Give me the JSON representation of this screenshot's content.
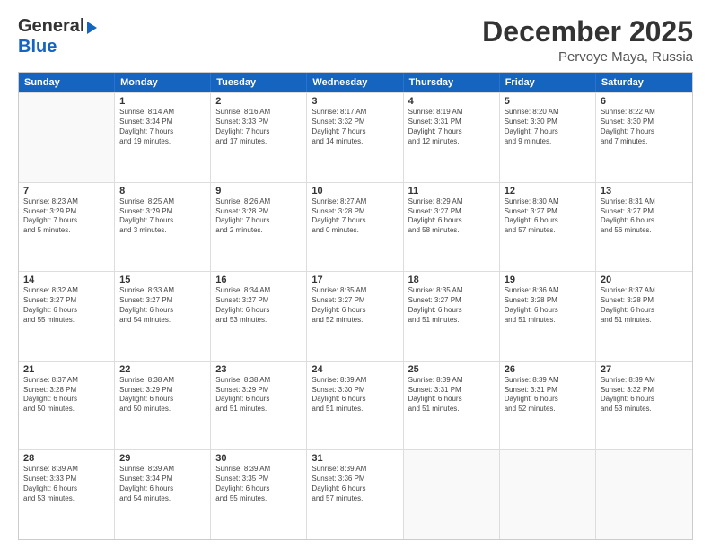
{
  "logo": {
    "line1": "General",
    "line2": "Blue"
  },
  "title": "December 2025",
  "location": "Pervoye Maya, Russia",
  "days": [
    "Sunday",
    "Monday",
    "Tuesday",
    "Wednesday",
    "Thursday",
    "Friday",
    "Saturday"
  ],
  "rows": [
    [
      {
        "day": "",
        "info": ""
      },
      {
        "day": "1",
        "info": "Sunrise: 8:14 AM\nSunset: 3:34 PM\nDaylight: 7 hours\nand 19 minutes."
      },
      {
        "day": "2",
        "info": "Sunrise: 8:16 AM\nSunset: 3:33 PM\nDaylight: 7 hours\nand 17 minutes."
      },
      {
        "day": "3",
        "info": "Sunrise: 8:17 AM\nSunset: 3:32 PM\nDaylight: 7 hours\nand 14 minutes."
      },
      {
        "day": "4",
        "info": "Sunrise: 8:19 AM\nSunset: 3:31 PM\nDaylight: 7 hours\nand 12 minutes."
      },
      {
        "day": "5",
        "info": "Sunrise: 8:20 AM\nSunset: 3:30 PM\nDaylight: 7 hours\nand 9 minutes."
      },
      {
        "day": "6",
        "info": "Sunrise: 8:22 AM\nSunset: 3:30 PM\nDaylight: 7 hours\nand 7 minutes."
      }
    ],
    [
      {
        "day": "7",
        "info": "Sunrise: 8:23 AM\nSunset: 3:29 PM\nDaylight: 7 hours\nand 5 minutes."
      },
      {
        "day": "8",
        "info": "Sunrise: 8:25 AM\nSunset: 3:29 PM\nDaylight: 7 hours\nand 3 minutes."
      },
      {
        "day": "9",
        "info": "Sunrise: 8:26 AM\nSunset: 3:28 PM\nDaylight: 7 hours\nand 2 minutes."
      },
      {
        "day": "10",
        "info": "Sunrise: 8:27 AM\nSunset: 3:28 PM\nDaylight: 7 hours\nand 0 minutes."
      },
      {
        "day": "11",
        "info": "Sunrise: 8:29 AM\nSunset: 3:27 PM\nDaylight: 6 hours\nand 58 minutes."
      },
      {
        "day": "12",
        "info": "Sunrise: 8:30 AM\nSunset: 3:27 PM\nDaylight: 6 hours\nand 57 minutes."
      },
      {
        "day": "13",
        "info": "Sunrise: 8:31 AM\nSunset: 3:27 PM\nDaylight: 6 hours\nand 56 minutes."
      }
    ],
    [
      {
        "day": "14",
        "info": "Sunrise: 8:32 AM\nSunset: 3:27 PM\nDaylight: 6 hours\nand 55 minutes."
      },
      {
        "day": "15",
        "info": "Sunrise: 8:33 AM\nSunset: 3:27 PM\nDaylight: 6 hours\nand 54 minutes."
      },
      {
        "day": "16",
        "info": "Sunrise: 8:34 AM\nSunset: 3:27 PM\nDaylight: 6 hours\nand 53 minutes."
      },
      {
        "day": "17",
        "info": "Sunrise: 8:35 AM\nSunset: 3:27 PM\nDaylight: 6 hours\nand 52 minutes."
      },
      {
        "day": "18",
        "info": "Sunrise: 8:35 AM\nSunset: 3:27 PM\nDaylight: 6 hours\nand 51 minutes."
      },
      {
        "day": "19",
        "info": "Sunrise: 8:36 AM\nSunset: 3:28 PM\nDaylight: 6 hours\nand 51 minutes."
      },
      {
        "day": "20",
        "info": "Sunrise: 8:37 AM\nSunset: 3:28 PM\nDaylight: 6 hours\nand 51 minutes."
      }
    ],
    [
      {
        "day": "21",
        "info": "Sunrise: 8:37 AM\nSunset: 3:28 PM\nDaylight: 6 hours\nand 50 minutes."
      },
      {
        "day": "22",
        "info": "Sunrise: 8:38 AM\nSunset: 3:29 PM\nDaylight: 6 hours\nand 50 minutes."
      },
      {
        "day": "23",
        "info": "Sunrise: 8:38 AM\nSunset: 3:29 PM\nDaylight: 6 hours\nand 51 minutes."
      },
      {
        "day": "24",
        "info": "Sunrise: 8:39 AM\nSunset: 3:30 PM\nDaylight: 6 hours\nand 51 minutes."
      },
      {
        "day": "25",
        "info": "Sunrise: 8:39 AM\nSunset: 3:31 PM\nDaylight: 6 hours\nand 51 minutes."
      },
      {
        "day": "26",
        "info": "Sunrise: 8:39 AM\nSunset: 3:31 PM\nDaylight: 6 hours\nand 52 minutes."
      },
      {
        "day": "27",
        "info": "Sunrise: 8:39 AM\nSunset: 3:32 PM\nDaylight: 6 hours\nand 53 minutes."
      }
    ],
    [
      {
        "day": "28",
        "info": "Sunrise: 8:39 AM\nSunset: 3:33 PM\nDaylight: 6 hours\nand 53 minutes."
      },
      {
        "day": "29",
        "info": "Sunrise: 8:39 AM\nSunset: 3:34 PM\nDaylight: 6 hours\nand 54 minutes."
      },
      {
        "day": "30",
        "info": "Sunrise: 8:39 AM\nSunset: 3:35 PM\nDaylight: 6 hours\nand 55 minutes."
      },
      {
        "day": "31",
        "info": "Sunrise: 8:39 AM\nSunset: 3:36 PM\nDaylight: 6 hours\nand 57 minutes."
      },
      {
        "day": "",
        "info": ""
      },
      {
        "day": "",
        "info": ""
      },
      {
        "day": "",
        "info": ""
      }
    ]
  ]
}
